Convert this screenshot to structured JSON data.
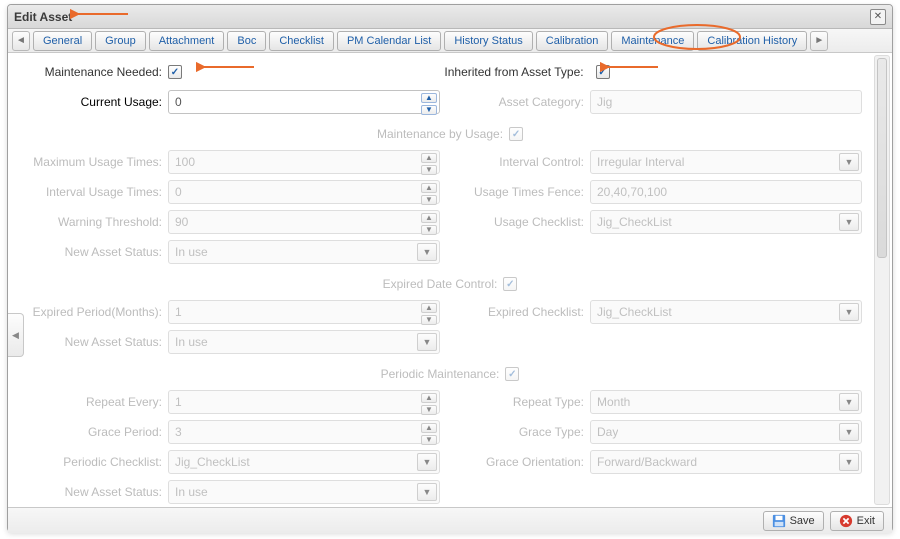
{
  "window": {
    "title": "Edit Asset"
  },
  "tabs": [
    "General",
    "Group",
    "Attachment",
    "Boc",
    "Checklist",
    "PM Calendar List",
    "History Status",
    "Calibration",
    "Maintenance",
    "Calibration History"
  ],
  "active_tab_index": 8,
  "header": {
    "maintenance_needed_label": "Maintenance Needed:",
    "maintenance_needed_checked": true,
    "inherited_label": "Inherited from Asset Type:",
    "inherited_checked": true
  },
  "current_usage": {
    "label": "Current Usage:",
    "value": "0"
  },
  "asset_category": {
    "label": "Asset Category:",
    "value": "Jig"
  },
  "sections": {
    "by_usage": {
      "title": "Maintenance by Usage:",
      "checked": true
    },
    "expired": {
      "title": "Expired Date Control:",
      "checked": true
    },
    "periodic": {
      "title": "Periodic Maintenance:",
      "checked": true
    }
  },
  "by_usage": {
    "max_usage": {
      "label": "Maximum Usage Times:",
      "value": "100"
    },
    "interval_control": {
      "label": "Interval Control:",
      "value": "Irregular Interval"
    },
    "interval_usage": {
      "label": "Interval Usage Times:",
      "value": "0"
    },
    "fence": {
      "label": "Usage Times Fence:",
      "value": "20,40,70,100"
    },
    "warn": {
      "label": "Warning Threshold:",
      "value": "90"
    },
    "usage_checklist": {
      "label": "Usage Checklist:",
      "value": "Jig_CheckList"
    },
    "status": {
      "label": "New Asset Status:",
      "value": "In use"
    }
  },
  "expired": {
    "period": {
      "label": "Expired Period(Months):",
      "value": "1"
    },
    "checklist": {
      "label": "Expired Checklist:",
      "value": "Jig_CheckList"
    },
    "status": {
      "label": "New Asset Status:",
      "value": "In use"
    }
  },
  "periodic": {
    "repeat_every": {
      "label": "Repeat Every:",
      "value": "1"
    },
    "repeat_type": {
      "label": "Repeat Type:",
      "value": "Month"
    },
    "grace_period": {
      "label": "Grace Period:",
      "value": "3"
    },
    "grace_type": {
      "label": "Grace Type:",
      "value": "Day"
    },
    "checklist": {
      "label": "Periodic Checklist:",
      "value": "Jig_CheckList"
    },
    "grace_orient": {
      "label": "Grace Orientation:",
      "value": "Forward/Backward"
    },
    "status": {
      "label": "New Asset Status:",
      "value": "In use"
    }
  },
  "footer": {
    "save": "Save",
    "exit": "Exit"
  },
  "colors": {
    "accent": "#1f5fa8",
    "annotation": "#e96a2b"
  }
}
